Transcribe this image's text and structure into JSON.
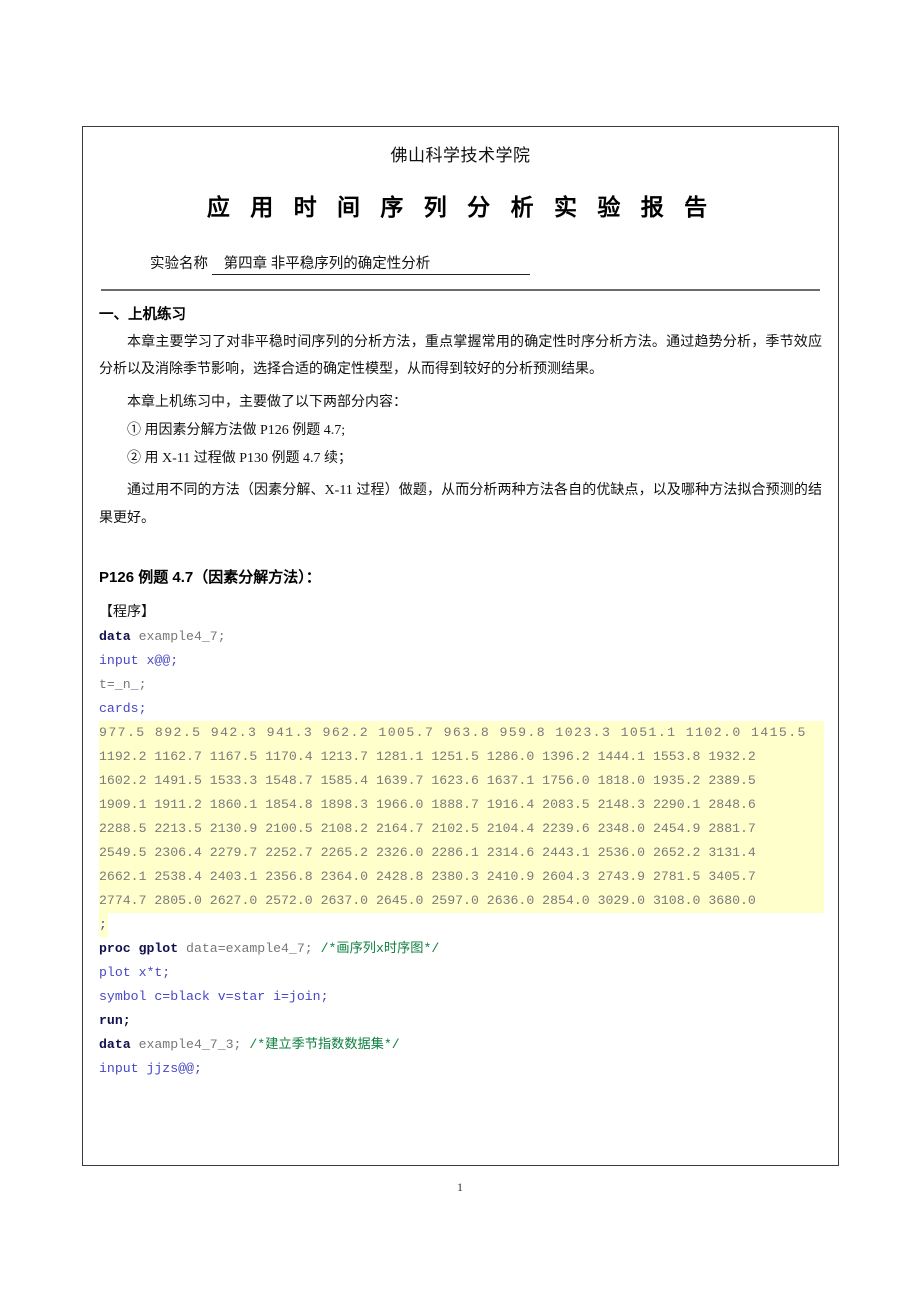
{
  "document": {
    "school": "佛山科学技术学院",
    "report_title": "应 用 时 间 序 列 分 析 实 验 报 告",
    "experiment_label": "实验名称",
    "experiment_value": "第四章   非平稳序列的确定性分析",
    "page_number": "1"
  },
  "section1": {
    "heading": "一、上机练习",
    "para1": "本章主要学习了对非平稳时间序列的分析方法，重点掌握常用的确定性时序分析方法。通过趋势分析，季节效应分析以及消除季节影响，选择合适的确定性模型，从而得到较好的分析预测结果。",
    "para2": "本章上机练习中，主要做了以下两部分内容：",
    "item1": "①  用因素分解方法做 P126 例题 4.7;",
    "item2": "②  用 X-11 过程做 P130 例题 4.7 续；",
    "para3": "通过用不同的方法（因素分解、X-11 过程）做题，从而分析两种方法各自的优缺点，以及哪种方法拟合预测的结果更好。"
  },
  "section2": {
    "subhead": "P126 例题 4.7（因素分解方法）：",
    "program_label": "【程序】"
  },
  "code": {
    "line1_kw": "data",
    "line1_rest": " example4_7;",
    "line2": "input x@@;",
    "line3": "t=_n_;",
    "line4_kw": "cards",
    "line4_rest": ";",
    "data_rows": [
      "977.5 892.5 942.3 941.3 962.2 1005.7 963.8 959.8 1023.3 1051.1 1102.0 1415.5",
      "1192.2 1162.7 1167.5 1170.4 1213.7 1281.1 1251.5 1286.0 1396.2 1444.1 1553.8 1932.2",
      "1602.2 1491.5 1533.3 1548.7 1585.4 1639.7 1623.6 1637.1 1756.0 1818.0 1935.2 2389.5",
      "1909.1 1911.2 1860.1 1854.8 1898.3 1966.0 1888.7 1916.4 2083.5 2148.3 2290.1 2848.6",
      "2288.5 2213.5 2130.9 2100.5 2108.2 2164.7 2102.5 2104.4 2239.6 2348.0 2454.9 2881.7",
      "2549.5 2306.4 2279.7 2252.7 2265.2 2326.0 2286.1 2314.6 2443.1 2536.0 2652.2 3131.4",
      "2662.1 2538.4 2403.1 2356.8 2364.0 2428.8 2380.3 2410.9 2604.3 2743.9 2781.5 3405.7",
      "2774.7 2805.0 2627.0 2572.0 2637.0 2645.0 2597.0 2636.0 2854.0 3029.0 3108.0 3680.0"
    ],
    "data_terminator": ";",
    "line5_kw": "proc gplot",
    "line5_rest": " data=example4_7; ",
    "line5_comment": "/*画序列x时序图*/",
    "line6": "plot x*t;",
    "line7": "symbol c=black v=star i=join;",
    "line8_kw": "run",
    "line8_rest": ";",
    "line9_kw": "data",
    "line9_rest": " example4_7_3; ",
    "line9_comment": "/*建立季节指数数据集*/",
    "line10": "input jjzs@@;"
  },
  "colors": {
    "highlight": "#FFFFCC",
    "keyword": "#11114F",
    "keyword_secondary": "#4747C7",
    "comment": "#0F8040",
    "plain_code": "#77777C",
    "border": "#3A3A44"
  }
}
